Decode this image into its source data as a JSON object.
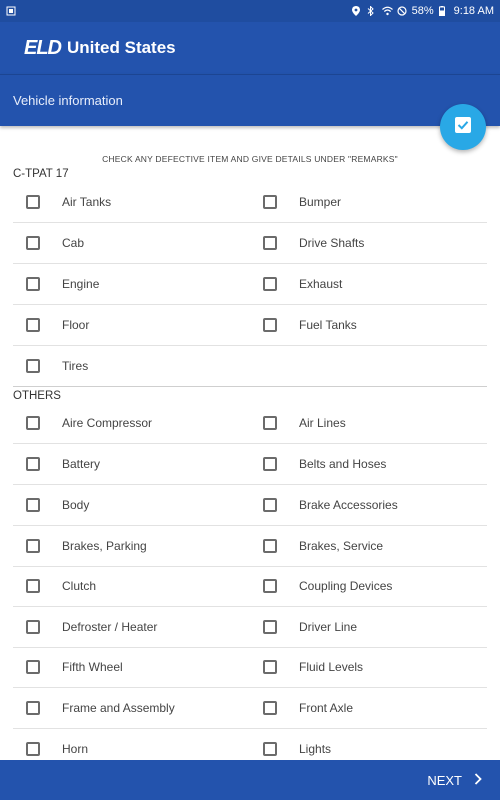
{
  "status": {
    "battery": "58%",
    "time": "9:18 AM"
  },
  "app": {
    "logo_mark": "ELD",
    "title": "United States",
    "brand_color": "#2353ad",
    "accent_color": "#29a8e6"
  },
  "screen": {
    "title": "Vehicle information",
    "instruction": "CHECK ANY DEFECTIVE ITEM AND GIVE DETAILS UNDER \"REMARKS\""
  },
  "sections": [
    {
      "title": "C-TPAT 17",
      "rows": [
        [
          "Air Tanks",
          "Bumper"
        ],
        [
          "Cab",
          "Drive Shafts"
        ],
        [
          "Engine",
          "Exhaust"
        ],
        [
          "Floor",
          "Fuel Tanks"
        ],
        [
          "Tires",
          ""
        ]
      ]
    },
    {
      "title": "OTHERS",
      "rows": [
        [
          "Aire Compressor",
          "Air Lines"
        ],
        [
          "Battery",
          "Belts and Hoses"
        ],
        [
          "Body",
          "Brake Accessories"
        ],
        [
          "Brakes, Parking",
          "Brakes, Service"
        ],
        [
          "Clutch",
          "Coupling Devices"
        ],
        [
          "Defroster / Heater",
          "Driver Line"
        ],
        [
          "Fifth Wheel",
          "Fluid Levels"
        ],
        [
          "Frame and Assembly",
          "Front Axle"
        ],
        [
          "Horn",
          "Lights"
        ]
      ]
    }
  ],
  "footer": {
    "next_label": "NEXT"
  }
}
